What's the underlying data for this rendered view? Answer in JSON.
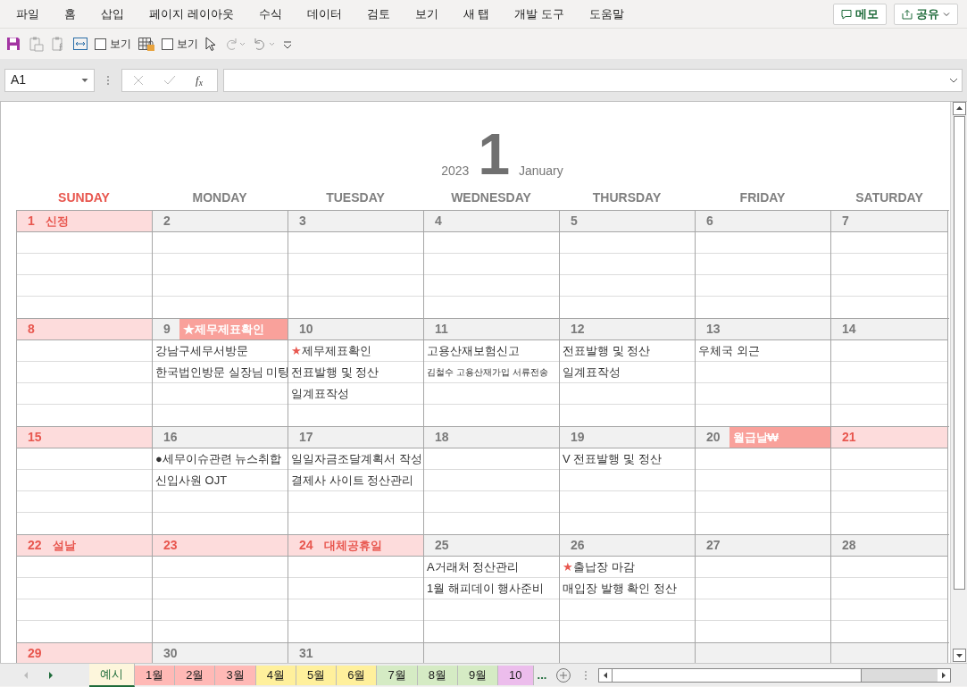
{
  "menu": [
    "파일",
    "홈",
    "삽입",
    "페이지 레이아웃",
    "수식",
    "데이터",
    "검토",
    "보기",
    "새 탭",
    "개발 도구",
    "도움말"
  ],
  "memo_button": "메모",
  "share_button": "공유",
  "toolbar": {
    "checkboxes": [
      {
        "label": "보기",
        "checked": false
      },
      {
        "label": "보기",
        "checked": false
      }
    ]
  },
  "name_box": "A1",
  "function_button": "f$_{x}$",
  "calendar": {
    "year": "2023",
    "month_number": "1",
    "month_name": "January",
    "weekdays": [
      {
        "label": "SUNDAY",
        "holiday": true
      },
      {
        "label": "MONDAY",
        "holiday": false
      },
      {
        "label": "TUESDAY",
        "holiday": false
      },
      {
        "label": "WEDNESDAY",
        "holiday": false
      },
      {
        "label": "THURSDAY",
        "holiday": false
      },
      {
        "label": "FRIDAY",
        "holiday": false
      },
      {
        "label": "SATURDAY",
        "holiday": false
      }
    ],
    "weeks": [
      [
        {
          "day": "1",
          "holiday": true,
          "label": {
            "kind": "holiday",
            "text": "신정"
          }
        },
        {
          "day": "2",
          "holiday": false
        },
        {
          "day": "3",
          "holiday": false
        },
        {
          "day": "4",
          "holiday": false
        },
        {
          "day": "5",
          "holiday": false
        },
        {
          "day": "6",
          "holiday": false
        },
        {
          "day": "7",
          "holiday": false
        }
      ],
      [
        {
          "day": "8",
          "holiday": true
        },
        {
          "day": "9",
          "holiday": false,
          "label": {
            "kind": "highlight",
            "text": "★제무제표확인"
          },
          "events": [
            {
              "text": "강남구세무서방문",
              "small": false
            },
            {
              "text": "한국법인방문 실장님 미팅",
              "small": false
            }
          ]
        },
        {
          "day": "10",
          "holiday": false,
          "events": [
            {
              "marker": "★",
              "text": "제무제표확인",
              "small": false
            },
            {
              "text": "전표발행 및 정산",
              "small": false
            },
            {
              "text": "일계표작성",
              "small": false
            }
          ]
        },
        {
          "day": "11",
          "holiday": false,
          "events": [
            {
              "text": "고용산재보험신고",
              "small": false
            },
            {
              "text": "김철수 고용산재가입 서류전송",
              "small": true
            }
          ]
        },
        {
          "day": "12",
          "holiday": false,
          "events": [
            {
              "text": "전표발행 및 정산",
              "small": false
            },
            {
              "text": "일계표작성",
              "small": false
            }
          ]
        },
        {
          "day": "13",
          "holiday": false,
          "events": [
            {
              "text": "우체국 외근",
              "small": false
            }
          ]
        },
        {
          "day": "14",
          "holiday": false
        }
      ],
      [
        {
          "day": "15",
          "holiday": true
        },
        {
          "day": "16",
          "holiday": false,
          "events": [
            {
              "text": "●세무이슈관련 뉴스취합",
              "small": false
            },
            {
              "text": "신입사원 OJT",
              "small": false
            }
          ]
        },
        {
          "day": "17",
          "holiday": false,
          "events": [
            {
              "text": "일일자금조달계획서 작성",
              "small": false
            },
            {
              "text": "결제사 사이트 정산관리",
              "small": false
            }
          ]
        },
        {
          "day": "18",
          "holiday": false
        },
        {
          "day": "19",
          "holiday": false,
          "events": [
            {
              "text": "V 전표발행 및 정산",
              "small": false
            }
          ]
        },
        {
          "day": "20",
          "holiday": false,
          "label": {
            "kind": "highlight",
            "text": "월급날₩"
          }
        },
        {
          "day": "21",
          "holiday": true
        }
      ],
      [
        {
          "day": "22",
          "holiday": true,
          "label": {
            "kind": "holiday",
            "text": "설날"
          }
        },
        {
          "day": "23",
          "holiday": true
        },
        {
          "day": "24",
          "holiday": true,
          "label": {
            "kind": "holiday",
            "text": "대체공휴일"
          }
        },
        {
          "day": "25",
          "holiday": false,
          "events": [
            {
              "text": "A거래처 정산관리",
              "small": false
            },
            {
              "text": "1월 해피데이 행사준비",
              "small": false
            }
          ]
        },
        {
          "day": "26",
          "holiday": false,
          "events": [
            {
              "marker": "★",
              "text": "출납장 마감",
              "small": false
            },
            {
              "text": "매입장 발행 확인 정산",
              "small": false
            }
          ]
        },
        {
          "day": "27",
          "holiday": false
        },
        {
          "day": "28",
          "holiday": false
        }
      ],
      [
        {
          "day": "29",
          "holiday": true
        },
        {
          "day": "30",
          "holiday": false
        },
        {
          "day": "31",
          "holiday": false
        }
      ]
    ]
  },
  "sheet_tabs": [
    {
      "label": "예시",
      "color": "#fdf6dc",
      "selected": true
    },
    {
      "label": "1월",
      "color": "#ffb9b6",
      "selected": false
    },
    {
      "label": "2월",
      "color": "#ffb9b6",
      "selected": false
    },
    {
      "label": "3월",
      "color": "#ffb9b6",
      "selected": false
    },
    {
      "label": "4월",
      "color": "#fff09c",
      "selected": false
    },
    {
      "label": "5월",
      "color": "#fff09c",
      "selected": false
    },
    {
      "label": "6월",
      "color": "#fff09c",
      "selected": false
    },
    {
      "label": "7월",
      "color": "#d5ebc4",
      "selected": false
    },
    {
      "label": "8월",
      "color": "#d5ebc4",
      "selected": false
    },
    {
      "label": "9월",
      "color": "#d5ebc4",
      "selected": false
    },
    {
      "label": "10",
      "color": "#ecbdec",
      "selected": false
    }
  ],
  "more_tabs": "..."
}
